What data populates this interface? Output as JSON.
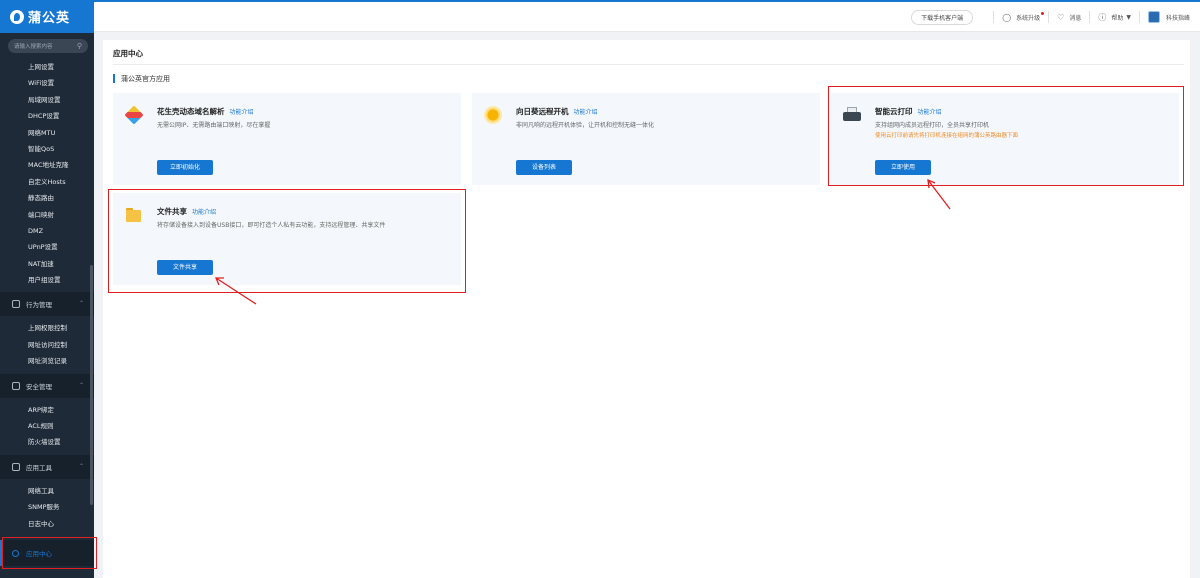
{
  "brand": {
    "name": "蒲公英"
  },
  "sidebar": {
    "search_placeholder": "请输入搜索内容",
    "network_items": [
      "上网设置",
      "WiFi设置",
      "局域网设置",
      "DHCP设置",
      "网络MTU",
      "智能QoS",
      "MAC地址克隆",
      "自定义Hosts",
      "静态路由",
      "端口映射",
      "DMZ",
      "UPnP设置",
      "NAT加速",
      "用户组设置"
    ],
    "groups": [
      {
        "label": "行为管理",
        "items": [
          "上网权限控制",
          "网址访问控制",
          "网址浏览记录"
        ]
      },
      {
        "label": "安全管理",
        "items": [
          "ARP绑定",
          "ACL规则",
          "防火墙设置"
        ]
      },
      {
        "label": "应用工具",
        "items": [
          "网络工具",
          "SNMP服务",
          "日志中心"
        ]
      }
    ],
    "active_item": "应用中心"
  },
  "header": {
    "download_label": "下载手机客户端",
    "upgrade_label": "系统升级",
    "messages_label": "消息",
    "help_label": "帮助",
    "user_label": "科技指峰"
  },
  "main": {
    "title": "应用中心",
    "section_title": "蒲公英官方应用",
    "intro_label": "功能介绍",
    "cards": [
      {
        "title": "花生壳动态域名解析",
        "desc": "无需公网IP、无需路由端口映射，尽在掌握",
        "warn": "",
        "button": "立即初始化",
        "icon": "cube-icon"
      },
      {
        "title": "向日葵远程开机",
        "desc": "非同凡响的远程开机体验，让开机和控制无缝一体化",
        "warn": "",
        "button": "设备列表",
        "icon": "sunflower-icon"
      },
      {
        "title": "智能云打印",
        "desc": "支持组网内成员远程打印，全员共享打印机",
        "warn": "使用云打印前请先将打印机连接在组网的蒲公英路由器下面",
        "button": "立即使用",
        "icon": "printer-icon"
      },
      {
        "title": "文件共享",
        "desc": "将存储设备接入到设备USB接口，即可打造个人私有云功能，支持远程管理、共享文件",
        "warn": "",
        "button": "文件共享",
        "icon": "folder-icon"
      }
    ]
  },
  "colors": {
    "accent": "#1677d2",
    "sidebar_bg": "#1e2a37",
    "highlight": "#e02020",
    "warning": "#f08a24"
  }
}
